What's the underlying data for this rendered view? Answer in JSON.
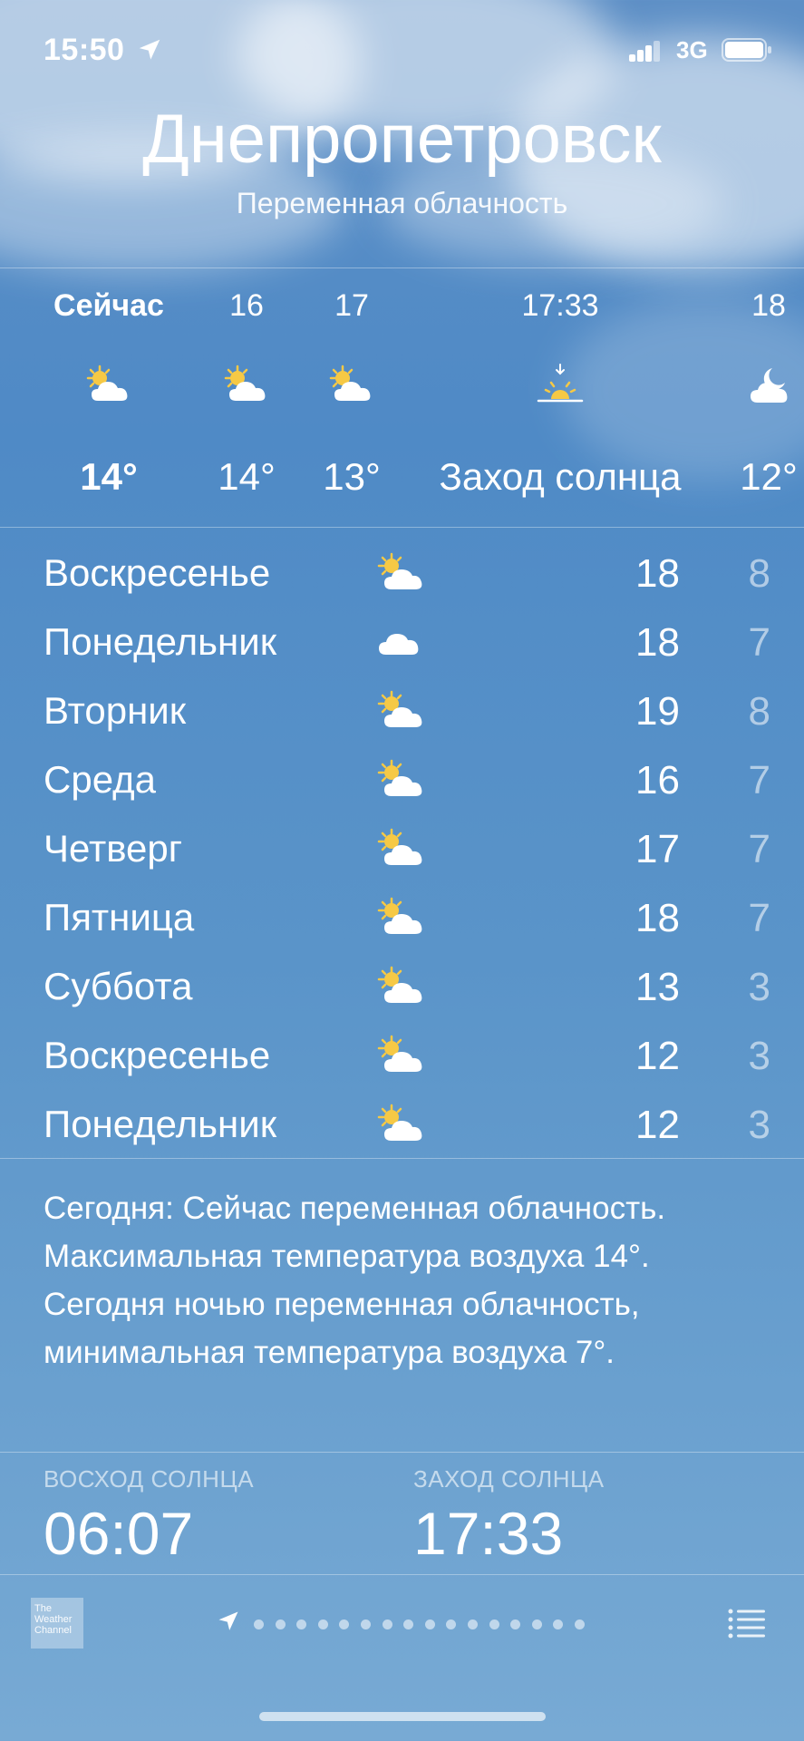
{
  "status": {
    "time": "15:50",
    "network": "3G"
  },
  "header": {
    "city": "Днепропетровск",
    "condition": "Переменная облачность"
  },
  "hourly": [
    {
      "label": "Сейчас",
      "icon": "partly-cloudy-icon",
      "temp": "14°",
      "bold": true
    },
    {
      "label": "16",
      "icon": "partly-cloudy-icon",
      "temp": "14°"
    },
    {
      "label": "17",
      "icon": "partly-cloudy-icon",
      "temp": "13°"
    },
    {
      "label": "17:33",
      "icon": "sunset-icon",
      "temp": "Заход солнца"
    },
    {
      "label": "18",
      "icon": "partly-cloudy-night-icon",
      "temp": "12°"
    }
  ],
  "daily": [
    {
      "day": "Воскресенье",
      "icon": "partly-cloudy-icon",
      "high": "18",
      "low": "8"
    },
    {
      "day": "Понедельник",
      "icon": "cloud-icon",
      "high": "18",
      "low": "7"
    },
    {
      "day": "Вторник",
      "icon": "partly-cloudy-icon",
      "high": "19",
      "low": "8"
    },
    {
      "day": "Среда",
      "icon": "partly-cloudy-icon",
      "high": "16",
      "low": "7"
    },
    {
      "day": "Четверг",
      "icon": "partly-cloudy-icon",
      "high": "17",
      "low": "7"
    },
    {
      "day": "Пятница",
      "icon": "partly-cloudy-icon",
      "high": "18",
      "low": "7"
    },
    {
      "day": "Суббота",
      "icon": "partly-cloudy-icon",
      "high": "13",
      "low": "3"
    },
    {
      "day": "Воскресенье",
      "icon": "partly-cloudy-icon",
      "high": "12",
      "low": "3"
    },
    {
      "day": "Понедельник",
      "icon": "partly-cloudy-icon",
      "high": "12",
      "low": "3"
    }
  ],
  "summary": "Сегодня: Сейчас переменная облачность. Максимальная температура воздуха 14°. Сегодня ночью переменная облачность, минимальная температура воздуха 7°.",
  "sun": {
    "sunrise_label": "ВОСХОД СОЛНЦА",
    "sunrise": "06:07",
    "sunset_label": "ЗАХОД СОЛНЦА",
    "sunset": "17:33"
  },
  "footer": {
    "provider": "The Weather Channel",
    "page_dots": 16
  },
  "colors": {
    "sun": "#f6c945",
    "background": "#5a94c9"
  }
}
